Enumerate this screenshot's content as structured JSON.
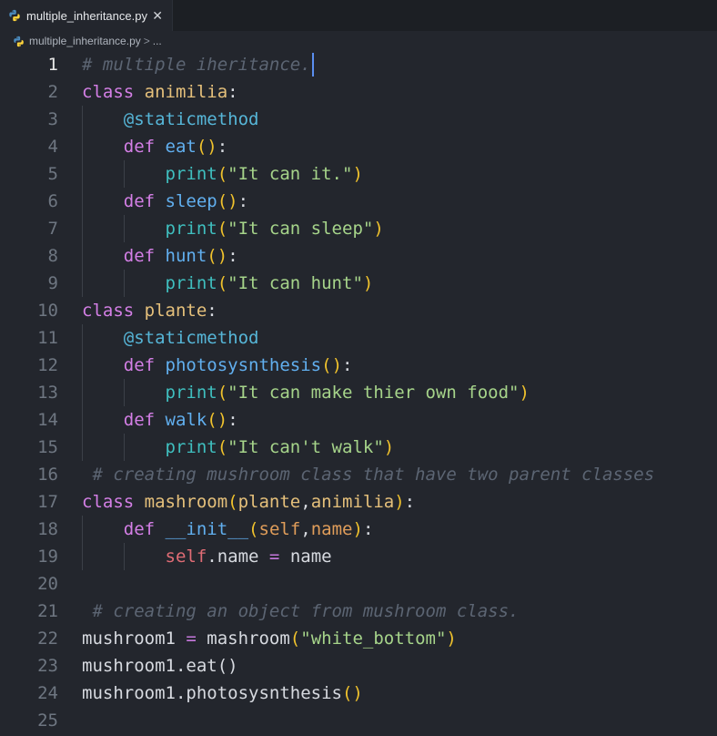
{
  "tab": {
    "filename": "multiple_inheritance.py",
    "close": "✕"
  },
  "breadcrumb": {
    "file": "multiple_inheritance.py",
    "sep": ">",
    "more": "..."
  },
  "editor": {
    "active_line": 1,
    "lines": [
      {
        "n": "1",
        "code": [
          [
            "cm",
            "# multiple iheritance."
          ]
        ]
      },
      {
        "n": "2",
        "code": [
          [
            "kw",
            "class "
          ],
          [
            "cls",
            "animilia"
          ],
          [
            "tx",
            ":"
          ]
        ]
      },
      {
        "n": "3",
        "code": [
          [
            "tx",
            "    "
          ],
          [
            "dec",
            "@staticmethod"
          ]
        ]
      },
      {
        "n": "4",
        "code": [
          [
            "tx",
            "    "
          ],
          [
            "kw",
            "def "
          ],
          [
            "fn",
            "eat"
          ],
          [
            "par",
            "()"
          ],
          [
            "tx",
            ":"
          ]
        ]
      },
      {
        "n": "5",
        "code": [
          [
            "tx",
            "        "
          ],
          [
            "pr",
            "print"
          ],
          [
            "par",
            "("
          ],
          [
            "str",
            "\"It can it.\""
          ],
          [
            "par",
            ")"
          ]
        ]
      },
      {
        "n": "6",
        "code": [
          [
            "tx",
            "    "
          ],
          [
            "kw",
            "def "
          ],
          [
            "fn",
            "sleep"
          ],
          [
            "par",
            "()"
          ],
          [
            "tx",
            ":"
          ]
        ]
      },
      {
        "n": "7",
        "code": [
          [
            "tx",
            "        "
          ],
          [
            "pr",
            "print"
          ],
          [
            "par",
            "("
          ],
          [
            "str",
            "\"It can sleep\""
          ],
          [
            "par",
            ")"
          ]
        ]
      },
      {
        "n": "8",
        "code": [
          [
            "tx",
            "    "
          ],
          [
            "kw",
            "def "
          ],
          [
            "fn",
            "hunt"
          ],
          [
            "par",
            "()"
          ],
          [
            "tx",
            ":"
          ]
        ]
      },
      {
        "n": "9",
        "code": [
          [
            "tx",
            "        "
          ],
          [
            "pr",
            "print"
          ],
          [
            "par",
            "("
          ],
          [
            "str",
            "\"It can hunt\""
          ],
          [
            "par",
            ")"
          ]
        ]
      },
      {
        "n": "10",
        "code": [
          [
            "kw",
            "class "
          ],
          [
            "cls",
            "plante"
          ],
          [
            "tx",
            ":"
          ]
        ]
      },
      {
        "n": "11",
        "code": [
          [
            "tx",
            "    "
          ],
          [
            "dec",
            "@staticmethod"
          ]
        ]
      },
      {
        "n": "12",
        "code": [
          [
            "tx",
            "    "
          ],
          [
            "kw",
            "def "
          ],
          [
            "fn",
            "photosysnthesis"
          ],
          [
            "par",
            "()"
          ],
          [
            "tx",
            ":"
          ]
        ]
      },
      {
        "n": "13",
        "code": [
          [
            "tx",
            "        "
          ],
          [
            "pr",
            "print"
          ],
          [
            "par",
            "("
          ],
          [
            "str",
            "\"It can make thier own food\""
          ],
          [
            "par",
            ")"
          ]
        ]
      },
      {
        "n": "14",
        "code": [
          [
            "tx",
            "    "
          ],
          [
            "kw",
            "def "
          ],
          [
            "fn",
            "walk"
          ],
          [
            "par",
            "()"
          ],
          [
            "tx",
            ":"
          ]
        ]
      },
      {
        "n": "15",
        "code": [
          [
            "tx",
            "        "
          ],
          [
            "pr",
            "print"
          ],
          [
            "par",
            "("
          ],
          [
            "str",
            "\"It can't walk\""
          ],
          [
            "par",
            ")"
          ]
        ]
      },
      {
        "n": "16",
        "code": [
          [
            "tx",
            " "
          ],
          [
            "cm",
            "# creating mushroom class that have two parent classes"
          ]
        ]
      },
      {
        "n": "17",
        "code": [
          [
            "kw",
            "class "
          ],
          [
            "cls",
            "mashroom"
          ],
          [
            "par",
            "("
          ],
          [
            "cls",
            "plante"
          ],
          [
            "tx",
            ","
          ],
          [
            "cls",
            "animilia"
          ],
          [
            "par",
            ")"
          ],
          [
            "tx",
            ":"
          ]
        ]
      },
      {
        "n": "18",
        "code": [
          [
            "tx",
            "    "
          ],
          [
            "kw",
            "def "
          ],
          [
            "dunder",
            "__init__"
          ],
          [
            "par",
            "("
          ],
          [
            "param",
            "self"
          ],
          [
            "tx",
            ","
          ],
          [
            "param",
            "name"
          ],
          [
            "par",
            ")"
          ],
          [
            "tx",
            ":"
          ]
        ]
      },
      {
        "n": "19",
        "code": [
          [
            "tx",
            "        "
          ],
          [
            "self",
            "self"
          ],
          [
            "tx",
            ".name "
          ],
          [
            "op",
            "="
          ],
          [
            "tx",
            " name"
          ]
        ]
      },
      {
        "n": "20",
        "code": []
      },
      {
        "n": "21",
        "code": [
          [
            "tx",
            " "
          ],
          [
            "cm",
            "# creating an object from mushroom class."
          ]
        ]
      },
      {
        "n": "22",
        "code": [
          [
            "tx",
            "mushroom1 "
          ],
          [
            "op",
            "="
          ],
          [
            "tx",
            " mashroom"
          ],
          [
            "par",
            "("
          ],
          [
            "str",
            "\"white_bottom\""
          ],
          [
            "par",
            ")"
          ]
        ]
      },
      {
        "n": "23",
        "code": [
          [
            "tx",
            "mushroom1.eat()"
          ]
        ]
      },
      {
        "n": "24",
        "code": [
          [
            "tx",
            "mushroom1.photosysnthesis"
          ],
          [
            "par",
            "()"
          ]
        ]
      },
      {
        "n": "25",
        "code": []
      }
    ]
  }
}
